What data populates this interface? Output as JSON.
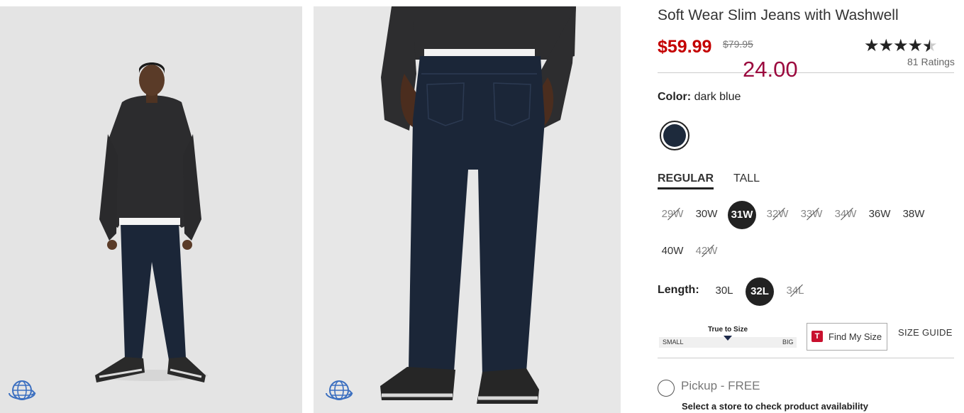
{
  "product": {
    "title": "Soft Wear Slim Jeans with Washwell",
    "sale_price": "$59.99",
    "original_price": "$79.95",
    "overlay_text": "24.00",
    "rating_count": "81 Ratings",
    "rating_value": 4.5
  },
  "images": [
    {
      "icon": "rotate-360-icon"
    },
    {
      "icon": "rotate-360-icon"
    }
  ],
  "color": {
    "label": "Color:",
    "value": "dark blue",
    "swatch_hex": "#1d2a3c"
  },
  "fit_tabs": [
    {
      "label": "REGULAR",
      "active": true
    },
    {
      "label": "TALL",
      "active": false
    }
  ],
  "waist_sizes": [
    {
      "label": "29W",
      "available": false
    },
    {
      "label": "30W",
      "available": true
    },
    {
      "label": "31W",
      "available": true,
      "selected": true
    },
    {
      "label": "32W",
      "available": false
    },
    {
      "label": "33W",
      "available": false
    },
    {
      "label": "34W",
      "available": false
    },
    {
      "label": "36W",
      "available": true
    },
    {
      "label": "38W",
      "available": true
    },
    {
      "label": "40W",
      "available": true
    },
    {
      "label": "42W",
      "available": false
    }
  ],
  "length": {
    "label": "Length:",
    "sizes": [
      {
        "label": "30L",
        "available": true
      },
      {
        "label": "32L",
        "available": true,
        "selected": true
      },
      {
        "label": "34L",
        "available": false
      }
    ]
  },
  "fit_meter": {
    "label": "True to Size",
    "min_label": "SMALL",
    "max_label": "BIG"
  },
  "find_my_size": {
    "icon_letter": "T",
    "label": "Find My Size"
  },
  "size_guide_label": "SIZE GUIDE",
  "pickup": {
    "label": "Pickup - FREE",
    "store_prompt": "Select a store to check product availability"
  },
  "colors": {
    "sale_red": "#c40000",
    "overlay_crimson": "#9b0a3e",
    "find_size_red": "#c8102e",
    "dark_text": "#222222"
  }
}
